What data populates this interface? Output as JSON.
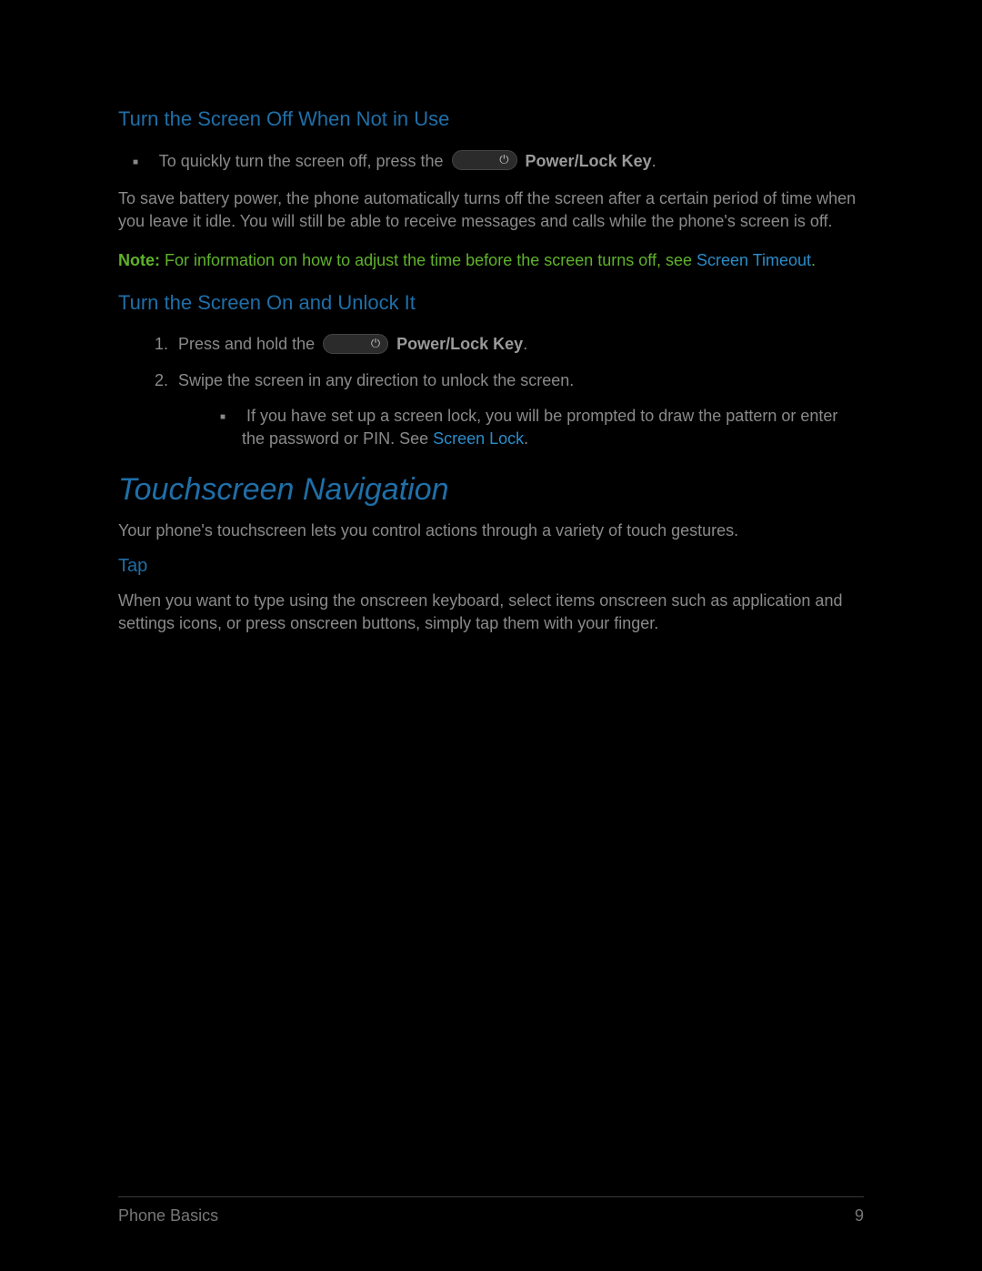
{
  "section1": {
    "heading": "Turn the Screen Off When Not in Use",
    "bullet_prefix": "To quickly turn the screen off, press the ",
    "bullet_key_label": "Power/Lock Key",
    "bullet_suffix": ".",
    "para": "To save battery power, the phone automatically turns off the screen after a certain period of time when you leave it idle. You will still be able to receive messages and calls while the phone's screen is off.",
    "note_label": "Note:",
    "note_text": " For information on how to adjust the time before the screen turns off, see ",
    "note_link": "Screen Timeout",
    "note_after": "."
  },
  "section2": {
    "heading": "Turn the Screen On and Unlock It",
    "step1_prefix": "Press and hold the ",
    "step1_key_label": "Power/Lock Key",
    "step1_suffix": ".",
    "step2": "Swipe the screen in any direction to unlock the screen.",
    "sub_prefix": "If you have set up a screen lock, you will be prompted to draw the pattern or enter the password or PIN. See ",
    "sub_link": "Screen Lock",
    "sub_suffix": "."
  },
  "section3": {
    "heading": "Touchscreen Navigation",
    "intro": "Your phone's touchscreen lets you control actions through a variety of touch gestures.",
    "sub_heading": "Tap",
    "para": "When you want to type using the onscreen keyboard, select items onscreen such as application and settings icons, or press onscreen buttons, simply tap them with your finger."
  },
  "footer": {
    "left": "Phone Basics",
    "right": "9"
  }
}
